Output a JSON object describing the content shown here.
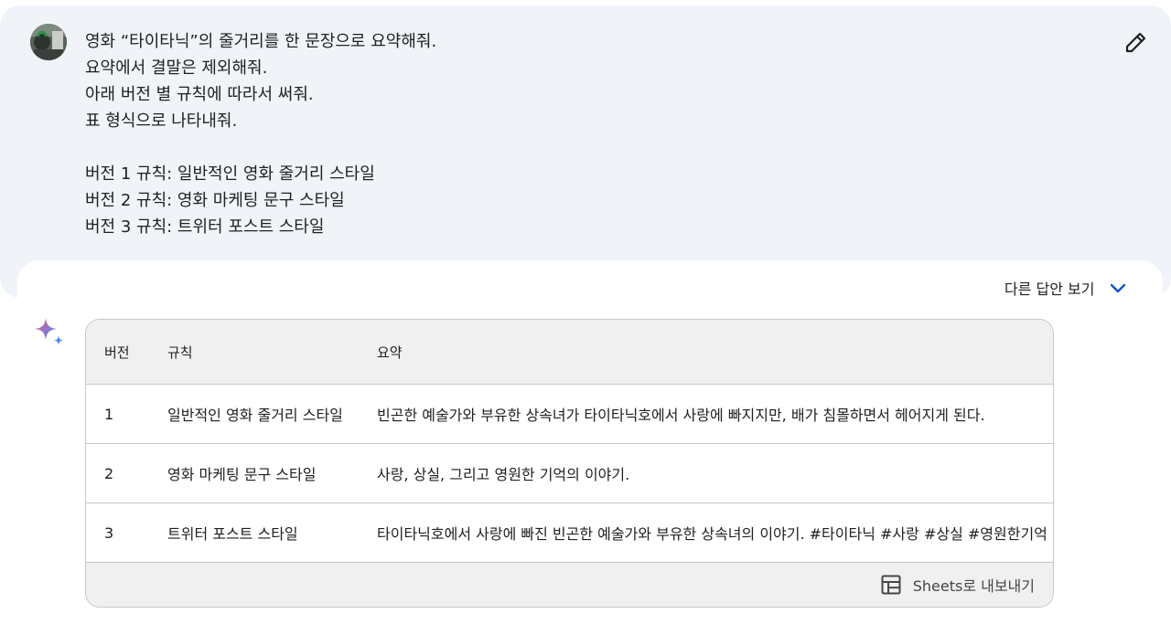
{
  "prompt": {
    "lines": [
      "영화 “타이타닉”의 줄거리를 한 문장으로 요약해줘.",
      "요약에서 결말은 제외해줘.",
      "아래 버전 별 규칙에 따라서 써줘.",
      "표 형식으로 나타내줘.",
      "",
      "버전 1 규칙: 일반적인 영화 줄거리 스타일",
      "버전 2 규칙: 영화 마케팅 문구 스타일",
      "버전 3 규칙: 트위터 포스트 스타일"
    ],
    "edit_icon": "pencil-icon"
  },
  "response": {
    "drafts_label": "다른 답안 보기",
    "drafts_icon": "chevron-down-icon",
    "drafts_icon_color": "#0b57d0",
    "assistant_icon": "sparkle-icon",
    "table": {
      "headers": [
        "버전",
        "규칙",
        "요약"
      ],
      "rows": [
        [
          "1",
          "일반적인 영화 줄거리 스타일",
          "빈곤한 예술가와 부유한 상속녀가 타이타닉호에서 사랑에 빠지지만, 배가 침몰하면서 헤어지게 된다."
        ],
        [
          "2",
          "영화 마케팅 문구 스타일",
          "사랑, 상실, 그리고 영원한 기억의 이야기."
        ],
        [
          "3",
          "트위터 포스트 스타일",
          "타이타닉호에서 사랑에 빠진 빈곤한 예술가와 부유한 상속녀의 이야기. #타이타닉 #사랑 #상실 #영원한기억"
        ]
      ],
      "export_label": "Sheets로 내보내기",
      "export_icon": "table-icon"
    }
  },
  "colors": {
    "prompt_bg": "#f0f4f9",
    "table_header_bg": "#f0f0f0",
    "border": "#c7c7c7"
  }
}
